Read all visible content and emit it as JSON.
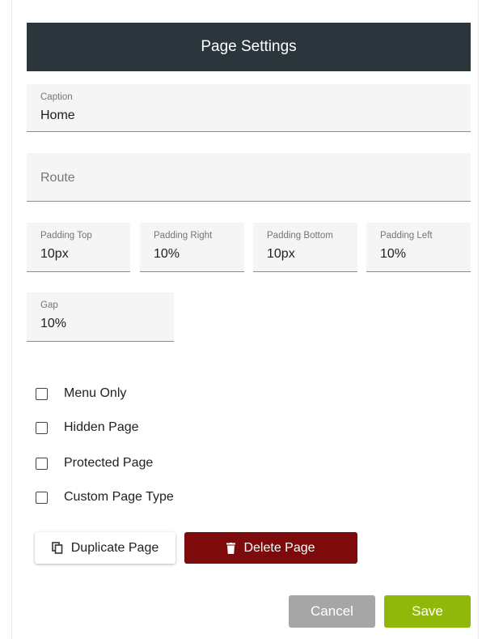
{
  "header": {
    "title": "Page Settings"
  },
  "fields": {
    "caption": {
      "label": "Caption",
      "value": "Home"
    },
    "route": {
      "placeholder": "Route"
    },
    "padding_top": {
      "label": "Padding Top",
      "value": "10px"
    },
    "padding_right": {
      "label": "Padding Right",
      "value": "10%"
    },
    "padding_bottom": {
      "label": "Padding Bottom",
      "value": "10px"
    },
    "padding_left": {
      "label": "Padding Left",
      "value": "10%"
    },
    "gap": {
      "label": "Gap",
      "value": "10%"
    }
  },
  "checkboxes": [
    {
      "label": "Menu Only",
      "checked": false
    },
    {
      "label": "Hidden Page",
      "checked": false
    },
    {
      "label": "Protected Page",
      "checked": false
    },
    {
      "label": "Custom Page Type",
      "checked": false
    }
  ],
  "actions": {
    "duplicate_label": "Duplicate Page",
    "duplicate_icon": "copy-icon",
    "delete_label": "Delete Page",
    "delete_icon": "trash-icon",
    "cancel_label": "Cancel",
    "save_label": "Save"
  },
  "colors": {
    "header_bg": "#2b363c",
    "delete_bg": "#7e0b0b",
    "cancel_bg": "#a6a6a6",
    "save_bg": "#8fb80a"
  }
}
